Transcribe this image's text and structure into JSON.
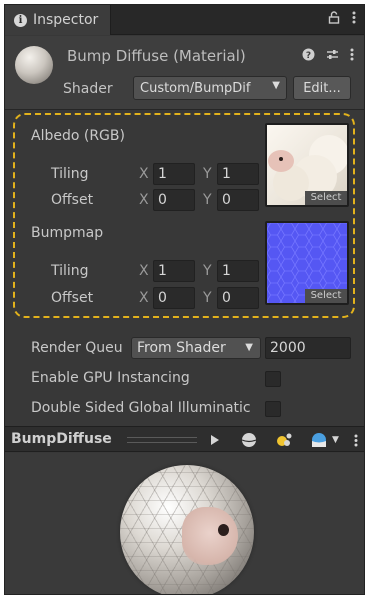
{
  "tab": {
    "title": "Inspector"
  },
  "header": {
    "material_title": "Bump Diffuse (Material)",
    "shader_label": "Shader",
    "shader_value": "Custom/BumpDif",
    "edit_label": "Edit..."
  },
  "albedo": {
    "label": "Albedo (RGB)",
    "tiling_label": "Tiling",
    "offset_label": "Offset",
    "tiling_x": "1",
    "tiling_y": "1",
    "offset_x": "0",
    "offset_y": "0",
    "select_label": "Select"
  },
  "bumpmap": {
    "label": "Bumpmap",
    "tiling_label": "Tiling",
    "offset_label": "Offset",
    "tiling_x": "1",
    "tiling_y": "1",
    "offset_x": "0",
    "offset_y": "0",
    "select_label": "Select"
  },
  "axes": {
    "x": "X",
    "y": "Y"
  },
  "render_queue": {
    "label": "Render Queu",
    "mode": "From Shader",
    "value": "2000"
  },
  "gpu_instancing": {
    "label": "Enable GPU Instancing",
    "checked": false
  },
  "double_sided_gi": {
    "label": "Double Sided Global Illuminatic",
    "checked": false
  },
  "preview": {
    "title": "BumpDiffuse"
  },
  "colors": {
    "highlight": "#e2b21c",
    "bump_texture": "#5a5cf6"
  },
  "icons": [
    "info-icon",
    "lock-icon",
    "kebab-menu-icon",
    "help-icon",
    "settings-icon",
    "play-icon",
    "sphere-icon",
    "light-icon",
    "skybox-icon"
  ]
}
